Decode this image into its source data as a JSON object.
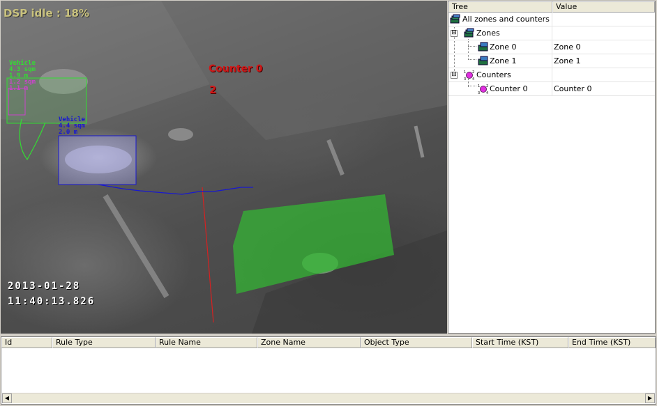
{
  "video": {
    "dsp_idle": "DSP idle : 18%",
    "objects": [
      {
        "type": "Vehicle",
        "area": "4.3 sqm",
        "height": "1.9 m",
        "extra1": "1.2 sqm",
        "extra2": "1.1 m",
        "color": "#33dd33"
      },
      {
        "type": "Vehicle",
        "area": "4.4 sqm",
        "height": "2.0 m",
        "color": "#1818d0"
      }
    ],
    "counter": {
      "name": "Counter 0",
      "count": "2",
      "color": "#d01818"
    },
    "date": "2013-01-28",
    "time": "11:40:13.826",
    "zone_color": "#33b833"
  },
  "tree": {
    "columns": [
      "Tree",
      "Value"
    ],
    "rows": [
      {
        "label": "All zones and counters",
        "value": "",
        "icon": "zones-icon"
      },
      {
        "label": "Zones",
        "value": "",
        "icon": "zone-group-icon",
        "expander": "⊟"
      },
      {
        "label": "Zone 0",
        "value": "Zone 0",
        "icon": "zone-icon"
      },
      {
        "label": "Zone 1",
        "value": "Zone 1",
        "icon": "zone-icon"
      },
      {
        "label": "Counters",
        "value": "",
        "icon": "counter-group-icon",
        "expander": "⊟"
      },
      {
        "label": "Counter 0",
        "value": "Counter 0",
        "icon": "counter-icon"
      }
    ]
  },
  "events": {
    "columns": [
      "Id",
      "Rule Type",
      "Rule Name",
      "Zone Name",
      "Object Type",
      "Start Time (KST)",
      "End Time (KST)"
    ],
    "rows": []
  }
}
